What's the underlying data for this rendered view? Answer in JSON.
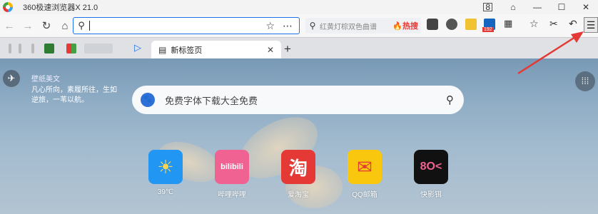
{
  "window": {
    "title": "360极速浏览器X 21.0",
    "badge": "8",
    "controls": [
      "⌂",
      "—",
      "☐",
      "✕"
    ]
  },
  "toolbar": {
    "back_icon": "←",
    "forward_icon": "→",
    "reload_icon": "↻",
    "home_icon": "⌂",
    "address_value": "",
    "star_icon": "☆",
    "more_icon": "⋯",
    "side_search_text": "红黄灯棕双色曲谱",
    "side_search_hot": "🔥热搜",
    "ext_badge": "192",
    "icons": {
      "favorites": "☆",
      "cut": "✂",
      "undo": "↶",
      "menu": "☰"
    }
  },
  "tabs": {
    "active_label": "新标签页",
    "active_icon": "▤",
    "close_icon": "✕",
    "new_tab_icon": "+",
    "play_icon": "▷"
  },
  "content": {
    "wallpaper_title": "壁纸美文",
    "wallpaper_poem": "凡心所向，素履所往，生如逆旅，一苇以航。",
    "search_placeholder": "免费字体下载大全免费",
    "search_icon": "⚲",
    "shortcuts": [
      {
        "label": "39℃",
        "glyph": "☀",
        "color": "#2196f3"
      },
      {
        "label": "哔哩哔哩",
        "glyph": "bilibili",
        "color": "#f06292"
      },
      {
        "label": "爱淘宝",
        "glyph": "淘",
        "color": "#e53935"
      },
      {
        "label": "QQ邮箱",
        "glyph": "✉",
        "color": "#f9c80e"
      },
      {
        "label": "快影铒",
        "glyph": "8O<",
        "color": "#111111"
      }
    ]
  },
  "colors": {
    "accent": "#1a73e8",
    "annotation_arrow": "#e53935"
  }
}
